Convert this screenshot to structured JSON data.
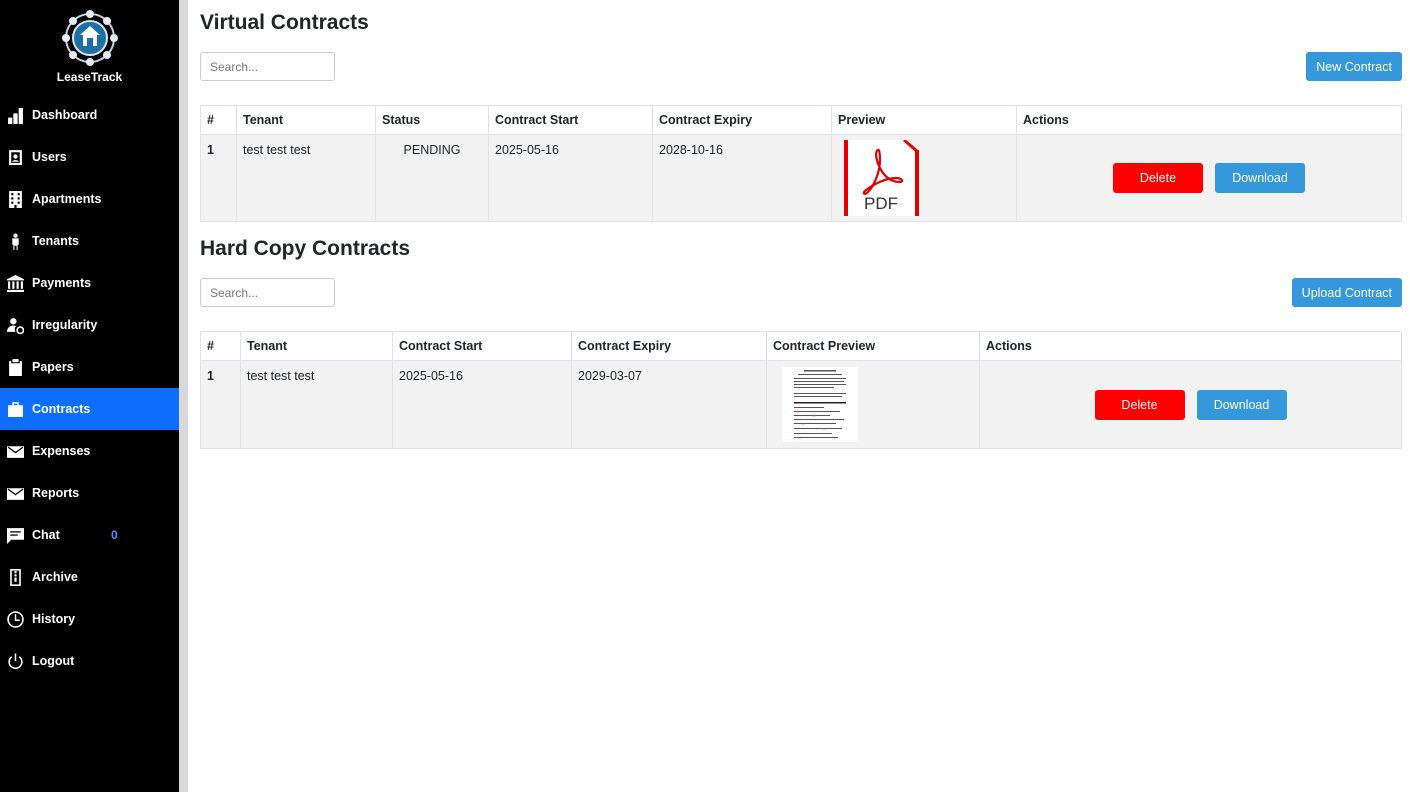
{
  "app": {
    "name": "LeaseTrack"
  },
  "sidebar": {
    "items": [
      {
        "label": "Dashboard",
        "icon": "bar-chart-icon"
      },
      {
        "label": "Users",
        "icon": "user-badge-icon"
      },
      {
        "label": "Apartments",
        "icon": "building-icon"
      },
      {
        "label": "Tenants",
        "icon": "person-icon"
      },
      {
        "label": "Payments",
        "icon": "bank-icon"
      },
      {
        "label": "Irregularity",
        "icon": "user-gear-icon"
      },
      {
        "label": "Papers",
        "icon": "clipboard-icon"
      },
      {
        "label": "Contracts",
        "icon": "briefcase-icon",
        "active": true
      },
      {
        "label": "Expenses",
        "icon": "envelope-open-icon"
      },
      {
        "label": "Reports",
        "icon": "envelope-open-icon"
      },
      {
        "label": "Chat",
        "icon": "chat-icon",
        "badge": "0"
      },
      {
        "label": "Archive",
        "icon": "zip-file-icon"
      },
      {
        "label": "History",
        "icon": "clock-icon"
      },
      {
        "label": "Logout",
        "icon": "power-icon"
      }
    ]
  },
  "virtual": {
    "title": "Virtual Contracts",
    "search_placeholder": "Search...",
    "new_button": "New Contract",
    "columns": [
      "#",
      "Tenant",
      "Status",
      "Contract Start",
      "Contract Expiry",
      "Preview",
      "Actions"
    ],
    "rows": [
      {
        "num": "1",
        "tenant": "test test test",
        "status": "PENDING",
        "start": "2025-05-16",
        "expiry": "2028-10-16",
        "preview_label": "PDF",
        "delete": "Delete",
        "download": "Download"
      }
    ]
  },
  "hardcopy": {
    "title": "Hard Copy Contracts",
    "search_placeholder": "Search...",
    "upload_button": "Upload Contract",
    "columns": [
      "#",
      "Tenant",
      "Contract Start",
      "Contract Expiry",
      "Contract Preview",
      "Actions"
    ],
    "rows": [
      {
        "num": "1",
        "tenant": "test test test",
        "start": "2025-05-16",
        "expiry": "2029-03-07",
        "delete": "Delete",
        "download": "Download"
      }
    ]
  },
  "colors": {
    "sidebar_bg": "#000000",
    "active": "#0d6efd",
    "primary_button": "#3498db",
    "delete_button": "#ff0000"
  }
}
